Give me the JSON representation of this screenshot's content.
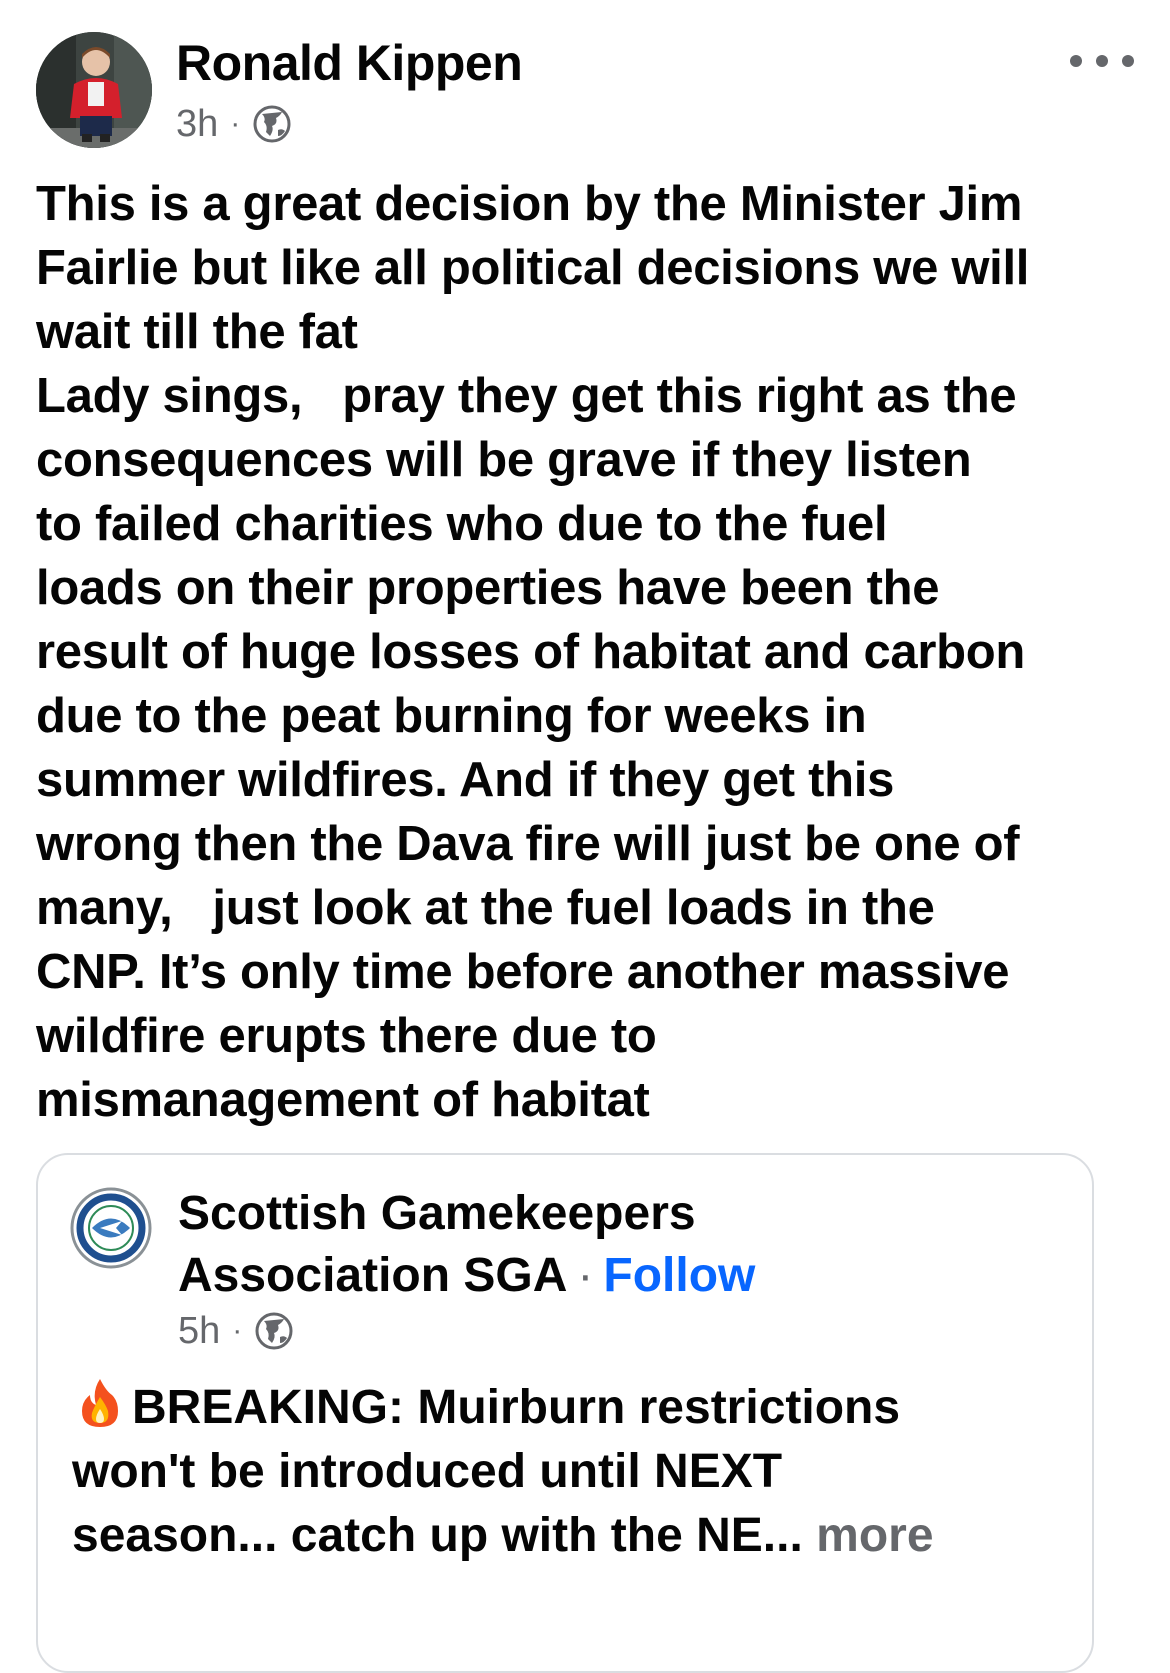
{
  "post": {
    "author_name": "Ronald Kippen",
    "timestamp": "3h",
    "meta_separator": "·",
    "audience_icon": "globe-icon",
    "more_icon": "more-options-icon",
    "text_lines": [
      "This is a great decision by the Minister Jim",
      "Fairlie but like all political decisions we will",
      "wait till the fat",
      "Lady sings,   pray they get this right as the",
      "consequences will be grave if they listen",
      "to failed charities who due to the fuel",
      "loads on their properties have been the",
      "result of huge losses of habitat and carbon",
      "due to the peat burning for weeks in",
      "summer wildfires. And if they get this",
      "wrong then the Dava fire will just be one of",
      "many,   just look at the fuel loads in the",
      "CNP. It’s only time before another massive",
      "wildfire erupts there due to",
      "mismanagement of habitat"
    ]
  },
  "shared_post": {
    "page_name_line1": "Scottish Gamekeepers",
    "page_name_line2": "Association SGA",
    "follow_separator": "·",
    "follow_label": "Follow",
    "timestamp": "5h",
    "meta_separator": "·",
    "audience_icon": "globe-icon",
    "logo_icon": "sga-logo",
    "emoji_icon": "fire-emoji-icon",
    "text_line1": "BREAKING: Muirburn restrictions",
    "text_line2": "won't be introduced until NEXT",
    "text_line3": "season... catch up with the NE...",
    "more_label": "more"
  },
  "colors": {
    "text_primary": "#050505",
    "text_secondary": "#65676b",
    "link_blue": "#0866ff",
    "card_border": "#dadde1"
  }
}
